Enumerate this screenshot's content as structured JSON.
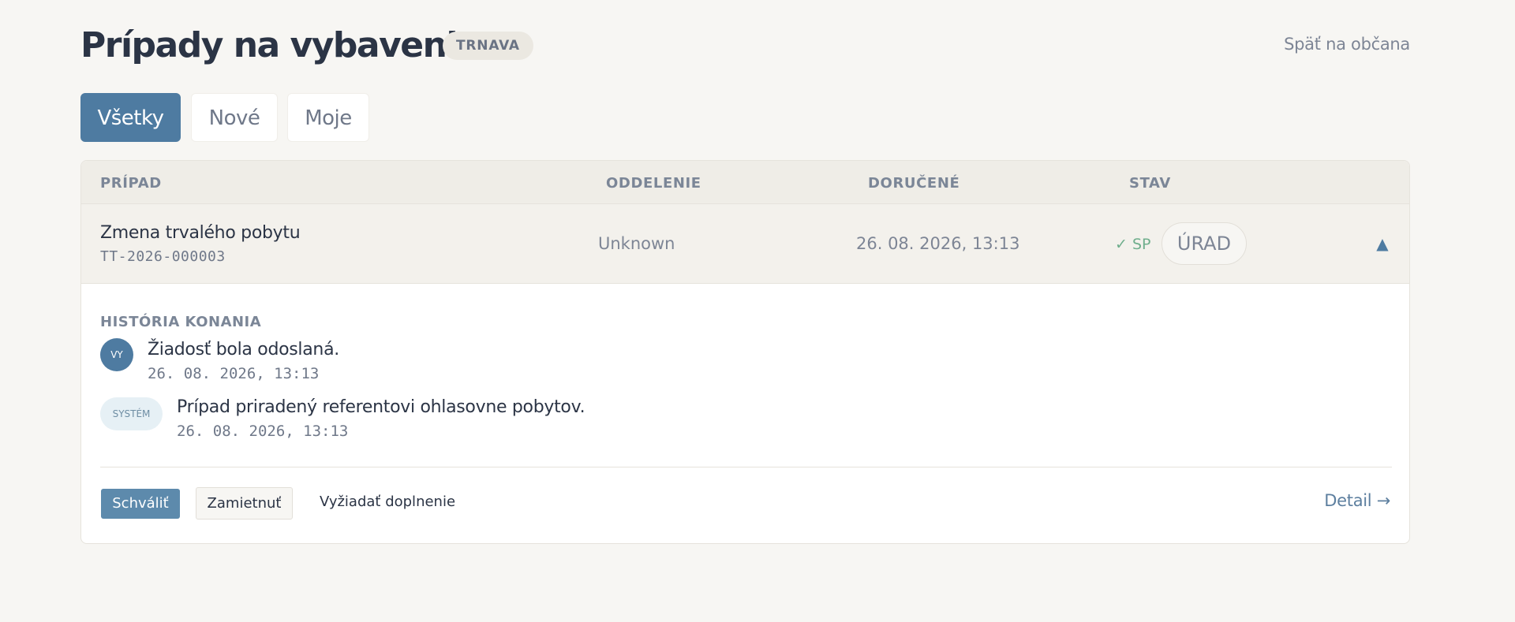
{
  "header": {
    "title": "Prípady na vybavenie",
    "city_badge": "TRNAVA",
    "back_link": "Späť na občana"
  },
  "tabs": [
    {
      "label": "Všetky",
      "active": true
    },
    {
      "label": "Nové",
      "active": false
    },
    {
      "label": "Moje",
      "active": false
    }
  ],
  "table": {
    "columns": [
      "PRÍPAD",
      "ODDELENIE",
      "DORUČENÉ",
      "STAV"
    ],
    "rows": [
      {
        "title": "Zmena trvalého pobytu",
        "id": "TT-2026-000003",
        "department": "Unknown",
        "delivered": "26. 08. 2026, 13:13",
        "status_check": "✓ SP",
        "status_pill": "ÚRAD",
        "collapse_icon": "▲"
      }
    ]
  },
  "details": {
    "history_title": "HISTÓRIA KONANIA",
    "history": [
      {
        "avatar": "VY",
        "text": "Žiadosť bola odoslaná.",
        "time": "26. 08. 2026, 13:13"
      },
      {
        "avatar": "SYSTÉM",
        "text": "Prípad priradený referentovi ohlasovne pobytov.",
        "time": "26. 08. 2026, 13:13"
      }
    ],
    "actions": {
      "approve": "Schváliť",
      "reject": "Zamietnuť",
      "request": "Vyžiadať doplnenie",
      "detail": "Detail →"
    }
  },
  "colors": {
    "accent": "#4e7ba1",
    "background": "#f7f6f3",
    "success": "#6fae8c"
  }
}
